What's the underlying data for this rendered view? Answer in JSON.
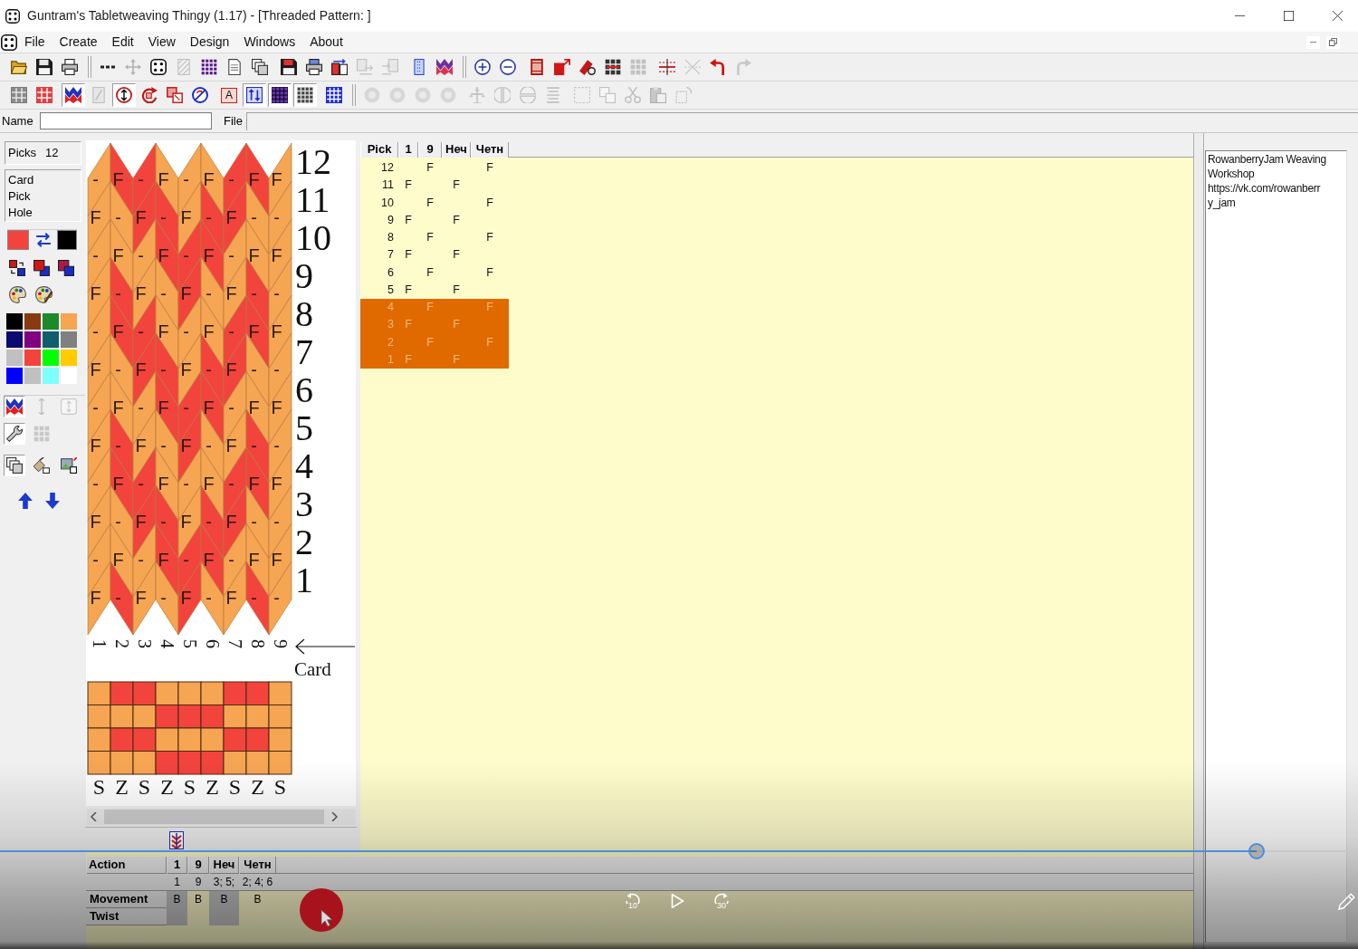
{
  "window": {
    "title": "Guntram's Tabletweaving Thingy (1.17) - [Threaded Pattern: ]"
  },
  "menu": [
    "File",
    "Create",
    "Edit",
    "View",
    "Design",
    "Windows",
    "About"
  ],
  "toolbars": [
    {
      "items": [
        {
          "kind": "button",
          "pressed": false,
          "disabled": false
        },
        {
          "kind": "button",
          "pressed": false,
          "disabled": false
        },
        {
          "kind": "button",
          "pressed": false,
          "disabled": false
        },
        {
          "kind": "separator"
        },
        {
          "kind": "button",
          "pressed": false,
          "disabled": false
        },
        {
          "kind": "button",
          "pressed": false,
          "disabled": true
        },
        {
          "kind": "button",
          "pressed": false,
          "disabled": false
        },
        {
          "kind": "button",
          "pressed": false,
          "disabled": true
        },
        {
          "kind": "button",
          "pressed": false,
          "disabled": false
        },
        {
          "kind": "button",
          "pressed": false,
          "disabled": false
        },
        {
          "kind": "button",
          "pressed": false,
          "disabled": false
        },
        {
          "kind": "space"
        },
        {
          "kind": "button",
          "pressed": false,
          "disabled": false
        },
        {
          "kind": "button",
          "pressed": false,
          "disabled": false
        },
        {
          "kind": "button",
          "pressed": false,
          "disabled": false
        },
        {
          "kind": "button",
          "pressed": false,
          "disabled": true
        },
        {
          "kind": "button",
          "pressed": false,
          "disabled": true
        },
        {
          "kind": "space"
        },
        {
          "kind": "button",
          "pressed": false,
          "disabled": false
        },
        {
          "kind": "button",
          "pressed": false,
          "disabled": false
        },
        {
          "kind": "separator"
        },
        {
          "kind": "button",
          "pressed": false,
          "disabled": false
        },
        {
          "kind": "button",
          "pressed": false,
          "disabled": false
        },
        {
          "kind": "space"
        },
        {
          "kind": "button",
          "pressed": false,
          "disabled": false
        },
        {
          "kind": "button",
          "pressed": false,
          "disabled": false
        },
        {
          "kind": "button",
          "pressed": false,
          "disabled": false
        },
        {
          "kind": "button",
          "pressed": false,
          "disabled": false
        },
        {
          "kind": "button",
          "pressed": false,
          "disabled": true
        },
        {
          "kind": "space"
        },
        {
          "kind": "button",
          "pressed": false,
          "disabled": false
        },
        {
          "kind": "button",
          "pressed": false,
          "disabled": true
        },
        {
          "kind": "button",
          "pressed": false,
          "disabled": false
        },
        {
          "kind": "button",
          "pressed": false,
          "disabled": true
        }
      ]
    },
    {
      "items": [
        {
          "kind": "button",
          "pressed": false,
          "disabled": false
        },
        {
          "kind": "button",
          "pressed": false,
          "disabled": false
        },
        {
          "kind": "space"
        },
        {
          "kind": "button",
          "pressed": true,
          "disabled": false
        },
        {
          "kind": "button",
          "pressed": false,
          "disabled": true
        },
        {
          "kind": "button",
          "pressed": true,
          "disabled": false
        },
        {
          "kind": "button",
          "pressed": false,
          "disabled": false
        },
        {
          "kind": "button",
          "pressed": false,
          "disabled": false
        },
        {
          "kind": "button",
          "pressed": false,
          "disabled": false
        },
        {
          "kind": "space"
        },
        {
          "kind": "button",
          "glyph": "A",
          "pressed": false,
          "disabled": false
        },
        {
          "kind": "button",
          "pressed": true,
          "disabled": false
        },
        {
          "kind": "button",
          "pressed": true,
          "disabled": false
        },
        {
          "kind": "button",
          "pressed": true,
          "disabled": false
        },
        {
          "kind": "space"
        },
        {
          "kind": "button",
          "pressed": false,
          "disabled": false
        },
        {
          "kind": "separator"
        },
        {
          "kind": "button",
          "pressed": false,
          "disabled": true
        },
        {
          "kind": "button",
          "pressed": false,
          "disabled": true
        },
        {
          "kind": "button",
          "pressed": false,
          "disabled": true
        },
        {
          "kind": "button",
          "pressed": false,
          "disabled": true
        },
        {
          "kind": "space"
        },
        {
          "kind": "button",
          "pressed": false,
          "disabled": true
        },
        {
          "kind": "button",
          "pressed": false,
          "disabled": true
        },
        {
          "kind": "button",
          "pressed": false,
          "disabled": true
        },
        {
          "kind": "button",
          "pressed": false,
          "disabled": true
        },
        {
          "kind": "space"
        },
        {
          "kind": "button",
          "pressed": false,
          "disabled": true
        },
        {
          "kind": "button",
          "pressed": false,
          "disabled": true
        },
        {
          "kind": "button",
          "pressed": false,
          "disabled": true
        },
        {
          "kind": "button",
          "pressed": false,
          "disabled": true
        },
        {
          "kind": "button",
          "pressed": false,
          "disabled": true
        }
      ]
    }
  ],
  "name_bar": {
    "name_label": "Name",
    "file_label": "File"
  },
  "side_panel": {
    "picks_label": "Picks",
    "picks_value": "12",
    "cursor_labels": [
      "Card",
      "Pick",
      "Hole"
    ],
    "current_colors": [
      {
        "color": "#f3433d"
      },
      {
        "color": "#000000"
      }
    ],
    "palette": [
      {
        "color": "#000000"
      },
      {
        "color": "#8a3a10"
      },
      {
        "color": "#1a8a2a"
      },
      {
        "color": "#f6a552"
      },
      {
        "color": "#0a0a70"
      },
      {
        "color": "#800080"
      },
      {
        "color": "#0f5e6e"
      },
      {
        "color": "#808080"
      },
      {
        "color": "#c0c0c0"
      },
      {
        "color": "#f3433d"
      },
      {
        "color": "#00ff00"
      },
      {
        "color": "#ffcc00"
      },
      {
        "color": "#0000ff"
      },
      {
        "color": "#c0c0c0"
      },
      {
        "color": "#80ffff"
      },
      {
        "color": "#ffffff"
      }
    ],
    "tool_rows": [
      [
        {
          "pressed": true,
          "disabled": false
        },
        {
          "pressed": false,
          "disabled": true
        },
        {
          "pressed": false,
          "disabled": true
        }
      ],
      [
        {
          "pressed": true,
          "disabled": false
        },
        {
          "pressed": false,
          "disabled": true
        }
      ],
      [
        {
          "pressed": true,
          "disabled": false
        },
        {
          "pressed": false,
          "disabled": false
        },
        {
          "pressed": false,
          "disabled": false
        }
      ]
    ]
  },
  "pattern": {
    "cards": [
      {
        "number": "1",
        "kind": "s",
        "twist": "S",
        "holes": [
          {
            "color": "#f6a552"
          },
          {
            "color": "#f6a552"
          },
          {
            "color": "#f6a552"
          },
          {
            "color": "#f6a552"
          }
        ]
      },
      {
        "number": "2",
        "kind": "z",
        "twist": "Z",
        "holes": [
          {
            "color": "#f3433d"
          },
          {
            "color": "#f6a552"
          },
          {
            "color": "#f3433d"
          },
          {
            "color": "#f6a552"
          }
        ]
      },
      {
        "number": "3",
        "kind": "s",
        "twist": "S",
        "holes": [
          {
            "color": "#f3433d"
          },
          {
            "color": "#f6a552"
          },
          {
            "color": "#f3433d"
          },
          {
            "color": "#f6a552"
          }
        ]
      },
      {
        "number": "4",
        "kind": "z",
        "twist": "Z",
        "holes": [
          {
            "color": "#f6a552"
          },
          {
            "color": "#f3433d"
          },
          {
            "color": "#f6a552"
          },
          {
            "color": "#f3433d"
          }
        ]
      },
      {
        "number": "5",
        "kind": "s",
        "twist": "S",
        "holes": [
          {
            "color": "#f6a552"
          },
          {
            "color": "#f3433d"
          },
          {
            "color": "#f6a552"
          },
          {
            "color": "#f3433d"
          }
        ]
      },
      {
        "number": "6",
        "kind": "z",
        "twist": "Z",
        "holes": [
          {
            "color": "#f6a552"
          },
          {
            "color": "#f3433d"
          },
          {
            "color": "#f6a552"
          },
          {
            "color": "#f3433d"
          }
        ]
      },
      {
        "number": "7",
        "kind": "s",
        "twist": "S",
        "holes": [
          {
            "color": "#f3433d"
          },
          {
            "color": "#f6a552"
          },
          {
            "color": "#f3433d"
          },
          {
            "color": "#f6a552"
          }
        ]
      },
      {
        "number": "8",
        "kind": "z",
        "twist": "Z",
        "holes": [
          {
            "color": "#f3433d"
          },
          {
            "color": "#f6a552"
          },
          {
            "color": "#f3433d"
          },
          {
            "color": "#f6a552"
          }
        ]
      },
      {
        "number": "9",
        "kind": "s",
        "twist": "S",
        "holes": [
          {
            "color": "#f6a552"
          },
          {
            "color": "#f6a552"
          },
          {
            "color": "#f6a552"
          },
          {
            "color": "#f6a552"
          }
        ]
      }
    ],
    "picks": [
      {
        "number": "12",
        "cells": [
          {
            "letter": "-",
            "color": "#f6a552"
          },
          {
            "letter": "F",
            "color": "#f3433d"
          },
          {
            "letter": "-",
            "color": "#f3433d"
          },
          {
            "letter": "F",
            "color": "#f6a552"
          },
          {
            "letter": "-",
            "color": "#f6a552"
          },
          {
            "letter": "F",
            "color": "#f6a552"
          },
          {
            "letter": "-",
            "color": "#f3433d"
          },
          {
            "letter": "F",
            "color": "#f3433d"
          },
          {
            "letter": "F",
            "color": "#f6a552"
          }
        ]
      },
      {
        "number": "11",
        "cells": [
          {
            "letter": "F",
            "color": "#f6a552"
          },
          {
            "letter": "-",
            "color": "#f6a552"
          },
          {
            "letter": "F",
            "color": "#f3433d"
          },
          {
            "letter": "-",
            "color": "#f3433d"
          },
          {
            "letter": "F",
            "color": "#f6a552"
          },
          {
            "letter": "-",
            "color": "#f3433d"
          },
          {
            "letter": "F",
            "color": "#f3433d"
          },
          {
            "letter": "-",
            "color": "#f6a552"
          },
          {
            "letter": "-",
            "color": "#f6a552"
          }
        ]
      },
      {
        "number": "10",
        "cells": [
          {
            "letter": "-",
            "color": "#f6a552"
          },
          {
            "letter": "F",
            "color": "#f6a552"
          },
          {
            "letter": "-",
            "color": "#f6a552"
          },
          {
            "letter": "F",
            "color": "#f3433d"
          },
          {
            "letter": "-",
            "color": "#f3433d"
          },
          {
            "letter": "F",
            "color": "#f3433d"
          },
          {
            "letter": "-",
            "color": "#f6a552"
          },
          {
            "letter": "F",
            "color": "#f6a552"
          },
          {
            "letter": "F",
            "color": "#f6a552"
          }
        ]
      },
      {
        "number": "9",
        "cells": [
          {
            "letter": "F",
            "color": "#f6a552"
          },
          {
            "letter": "-",
            "color": "#f3433d"
          },
          {
            "letter": "F",
            "color": "#f6a552"
          },
          {
            "letter": "-",
            "color": "#f6a552"
          },
          {
            "letter": "F",
            "color": "#f3433d"
          },
          {
            "letter": "-",
            "color": "#f6a552"
          },
          {
            "letter": "F",
            "color": "#f6a552"
          },
          {
            "letter": "-",
            "color": "#f3433d"
          },
          {
            "letter": "-",
            "color": "#f6a552"
          }
        ]
      },
      {
        "number": "8",
        "cells": [
          {
            "letter": "-",
            "color": "#f6a552"
          },
          {
            "letter": "F",
            "color": "#f3433d"
          },
          {
            "letter": "-",
            "color": "#f3433d"
          },
          {
            "letter": "F",
            "color": "#f6a552"
          },
          {
            "letter": "-",
            "color": "#f6a552"
          },
          {
            "letter": "F",
            "color": "#f6a552"
          },
          {
            "letter": "-",
            "color": "#f3433d"
          },
          {
            "letter": "F",
            "color": "#f3433d"
          },
          {
            "letter": "F",
            "color": "#f6a552"
          }
        ]
      },
      {
        "number": "7",
        "cells": [
          {
            "letter": "F",
            "color": "#f6a552"
          },
          {
            "letter": "-",
            "color": "#f6a552"
          },
          {
            "letter": "F",
            "color": "#f3433d"
          },
          {
            "letter": "-",
            "color": "#f3433d"
          },
          {
            "letter": "F",
            "color": "#f6a552"
          },
          {
            "letter": "-",
            "color": "#f3433d"
          },
          {
            "letter": "F",
            "color": "#f3433d"
          },
          {
            "letter": "-",
            "color": "#f6a552"
          },
          {
            "letter": "-",
            "color": "#f6a552"
          }
        ]
      },
      {
        "number": "6",
        "cells": [
          {
            "letter": "-",
            "color": "#f6a552"
          },
          {
            "letter": "F",
            "color": "#f6a552"
          },
          {
            "letter": "-",
            "color": "#f6a552"
          },
          {
            "letter": "F",
            "color": "#f3433d"
          },
          {
            "letter": "-",
            "color": "#f3433d"
          },
          {
            "letter": "F",
            "color": "#f3433d"
          },
          {
            "letter": "-",
            "color": "#f6a552"
          },
          {
            "letter": "F",
            "color": "#f6a552"
          },
          {
            "letter": "F",
            "color": "#f6a552"
          }
        ]
      },
      {
        "number": "5",
        "cells": [
          {
            "letter": "F",
            "color": "#f6a552"
          },
          {
            "letter": "-",
            "color": "#f3433d"
          },
          {
            "letter": "F",
            "color": "#f6a552"
          },
          {
            "letter": "-",
            "color": "#f6a552"
          },
          {
            "letter": "F",
            "color": "#f3433d"
          },
          {
            "letter": "-",
            "color": "#f6a552"
          },
          {
            "letter": "F",
            "color": "#f6a552"
          },
          {
            "letter": "-",
            "color": "#f3433d"
          },
          {
            "letter": "-",
            "color": "#f6a552"
          }
        ]
      },
      {
        "number": "4",
        "cells": [
          {
            "letter": "-",
            "color": "#f6a552"
          },
          {
            "letter": "F",
            "color": "#f3433d"
          },
          {
            "letter": "-",
            "color": "#f3433d"
          },
          {
            "letter": "F",
            "color": "#f6a552"
          },
          {
            "letter": "-",
            "color": "#f6a552"
          },
          {
            "letter": "F",
            "color": "#f6a552"
          },
          {
            "letter": "-",
            "color": "#f3433d"
          },
          {
            "letter": "F",
            "color": "#f3433d"
          },
          {
            "letter": "F",
            "color": "#f6a552"
          }
        ]
      },
      {
        "number": "3",
        "cells": [
          {
            "letter": "F",
            "color": "#f6a552"
          },
          {
            "letter": "-",
            "color": "#f6a552"
          },
          {
            "letter": "F",
            "color": "#f3433d"
          },
          {
            "letter": "-",
            "color": "#f3433d"
          },
          {
            "letter": "F",
            "color": "#f6a552"
          },
          {
            "letter": "-",
            "color": "#f3433d"
          },
          {
            "letter": "F",
            "color": "#f3433d"
          },
          {
            "letter": "-",
            "color": "#f6a552"
          },
          {
            "letter": "-",
            "color": "#f6a552"
          }
        ]
      },
      {
        "number": "2",
        "cells": [
          {
            "letter": "-",
            "color": "#f6a552"
          },
          {
            "letter": "F",
            "color": "#f6a552"
          },
          {
            "letter": "-",
            "color": "#f6a552"
          },
          {
            "letter": "F",
            "color": "#f3433d"
          },
          {
            "letter": "-",
            "color": "#f3433d"
          },
          {
            "letter": "F",
            "color": "#f3433d"
          },
          {
            "letter": "-",
            "color": "#f6a552"
          },
          {
            "letter": "F",
            "color": "#f6a552"
          },
          {
            "letter": "F",
            "color": "#f6a552"
          }
        ]
      },
      {
        "number": "1",
        "cells": [
          {
            "letter": "F",
            "color": "#f6a552"
          },
          {
            "letter": "-",
            "color": "#f3433d"
          },
          {
            "letter": "F",
            "color": "#f6a552"
          },
          {
            "letter": "-",
            "color": "#f6a552"
          },
          {
            "letter": "F",
            "color": "#f3433d"
          },
          {
            "letter": "-",
            "color": "#f6a552"
          },
          {
            "letter": "F",
            "color": "#f6a552"
          },
          {
            "letter": "-",
            "color": "#f3433d"
          },
          {
            "letter": "-",
            "color": "#f6a552"
          }
        ]
      }
    ],
    "card_label": "Card"
  },
  "pick_table": {
    "columns": [
      "Pick",
      "1",
      "9",
      "Неч",
      "Четн"
    ],
    "rows": [
      {
        "cells": [
          "12",
          "",
          "F",
          "",
          "F"
        ],
        "selected": false
      },
      {
        "cells": [
          "11",
          "F",
          "",
          "F",
          ""
        ],
        "selected": false
      },
      {
        "cells": [
          "10",
          "",
          "F",
          "",
          "F"
        ],
        "selected": false
      },
      {
        "cells": [
          "9",
          "F",
          "",
          "F",
          ""
        ],
        "selected": false
      },
      {
        "cells": [
          "8",
          "",
          "F",
          "",
          "F"
        ],
        "selected": false
      },
      {
        "cells": [
          "7",
          "F",
          "",
          "F",
          ""
        ],
        "selected": false
      },
      {
        "cells": [
          "6",
          "",
          "F",
          "",
          "F"
        ],
        "selected": false
      },
      {
        "cells": [
          "5",
          "F",
          "",
          "F",
          ""
        ],
        "selected": false
      },
      {
        "cells": [
          "4",
          "",
          "F",
          "",
          "F"
        ],
        "selected": true
      },
      {
        "cells": [
          "3",
          "F",
          "",
          "F",
          ""
        ],
        "selected": true
      },
      {
        "cells": [
          "2",
          "",
          "F",
          "",
          "F"
        ],
        "selected": true
      },
      {
        "cells": [
          "1",
          "F",
          "",
          "F",
          ""
        ],
        "selected": true
      }
    ]
  },
  "notes": {
    "lines": [
      "RowanberryJam Weaving",
      "Workshop",
      "https://vk.com/rowanberr",
      "y_jam"
    ]
  },
  "action_table": {
    "columns": [
      {
        "label": "Action",
        "shaded": true
      },
      {
        "label": "1",
        "shaded": true
      },
      {
        "label": "9",
        "shaded": false
      },
      {
        "label": "Неч",
        "shaded": true
      },
      {
        "label": "Четн",
        "shaded": false
      }
    ],
    "rows": [
      {
        "kind": "cards",
        "cells": [
          "",
          "1",
          "9",
          "3; 5;",
          "2; 4; 6"
        ]
      },
      {
        "kind": "setting",
        "cells": [
          "Movement",
          "B",
          "B",
          "B",
          "B"
        ]
      },
      {
        "kind": "setting",
        "cells": [
          "Twist",
          "",
          "",
          "",
          ""
        ]
      }
    ]
  },
  "video": {
    "progress": {
      "level": 0.925
    },
    "rewind_label": "10",
    "forward_label": "30"
  }
}
